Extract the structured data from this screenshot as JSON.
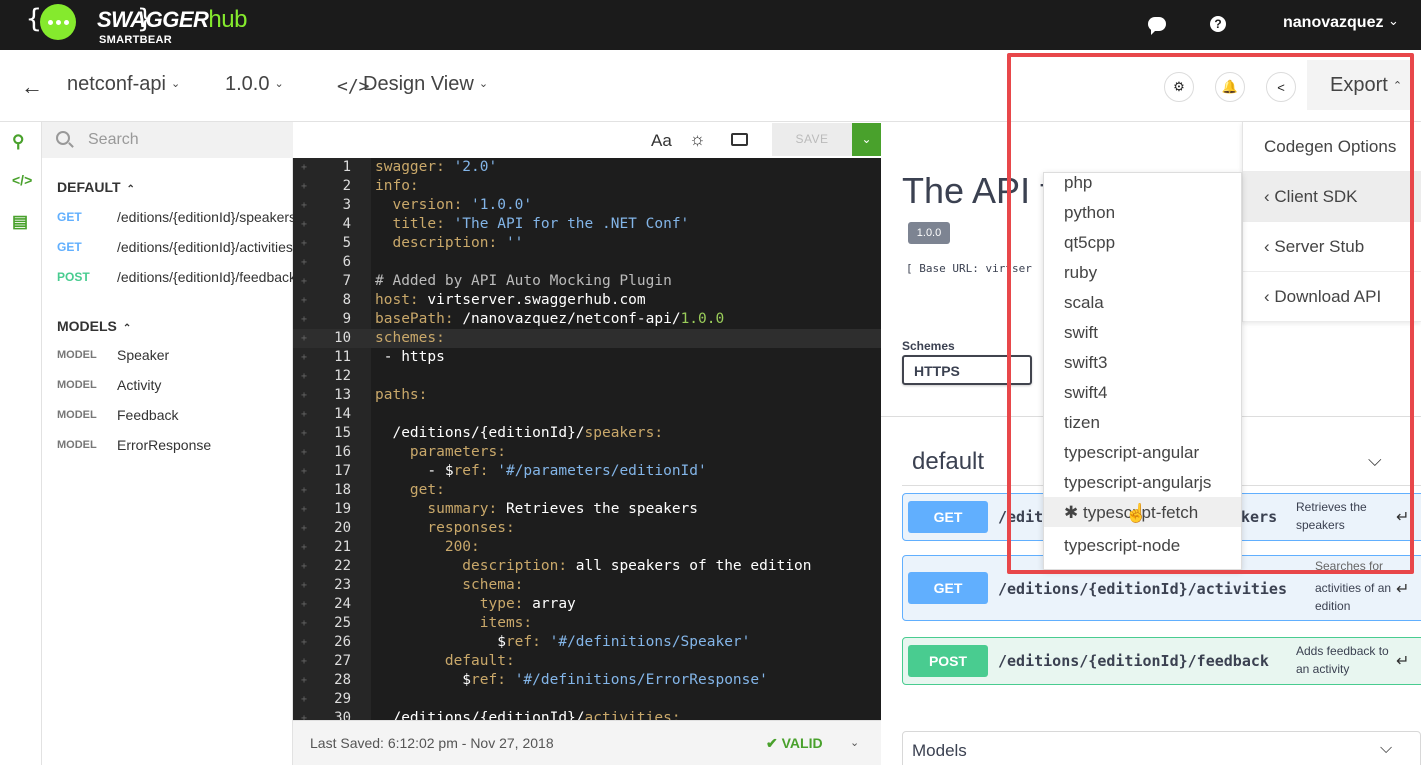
{
  "brand": {
    "name_a": "SWAGGER",
    "name_b": "hub",
    "sub": "SMARTBEAR",
    "braces": "{ }",
    "accent": "#85ea2d"
  },
  "topbar": {
    "username": "nanovazquez",
    "chat_icon": "chat-icon",
    "help_icon": "help-icon"
  },
  "subbar": {
    "api_name": "netconf-api",
    "version": "1.0.0",
    "view": "Design View",
    "export_label": "Export"
  },
  "sidebar": {
    "search_placeholder": "Search",
    "default_section": "DEFAULT",
    "operations": [
      {
        "verb": "GET",
        "path": "/editions/{editionId}/speakers"
      },
      {
        "verb": "GET",
        "path": "/editions/{editionId}/activities"
      },
      {
        "verb": "POST",
        "path": "/editions/{editionId}/feedback"
      }
    ],
    "models_section": "MODELS",
    "model_tag": "MODEL",
    "models": [
      "Speaker",
      "Activity",
      "Feedback",
      "ErrorResponse"
    ]
  },
  "editor": {
    "save_label": "SAVE",
    "font_icon_label": "Aa",
    "lines": [
      {
        "n": "1",
        "parts": [
          [
            "k",
            "swagger: "
          ],
          [
            "s",
            "'2.0'"
          ]
        ]
      },
      {
        "n": "2",
        "parts": [
          [
            "k",
            "info:"
          ]
        ]
      },
      {
        "n": "3",
        "parts": [
          [
            "k",
            "  version: "
          ],
          [
            "s",
            "'1.0.0'"
          ]
        ]
      },
      {
        "n": "4",
        "parts": [
          [
            "k",
            "  title: "
          ],
          [
            "s",
            "'The API for the .NET Conf'"
          ]
        ]
      },
      {
        "n": "5",
        "parts": [
          [
            "k",
            "  description: "
          ],
          [
            "s",
            "''"
          ]
        ]
      },
      {
        "n": "6",
        "parts": []
      },
      {
        "n": "7",
        "parts": [
          [
            "cm",
            "# Added by API Auto Mocking Plugin"
          ]
        ]
      },
      {
        "n": "8",
        "parts": [
          [
            "k",
            "host: "
          ],
          [
            "w",
            "virtserver.swaggerhub.com"
          ]
        ]
      },
      {
        "n": "9",
        "parts": [
          [
            "k",
            "basePath: "
          ],
          [
            "w",
            "/nanovazquez/netconf-api/"
          ],
          [
            "n",
            "1.0.0"
          ]
        ]
      },
      {
        "n": "10",
        "parts": [
          [
            "k",
            "schemes:"
          ]
        ],
        "active": true
      },
      {
        "n": "11",
        "parts": [
          [
            "w",
            " - https"
          ]
        ]
      },
      {
        "n": "12",
        "parts": []
      },
      {
        "n": "13",
        "parts": [
          [
            "k",
            "paths:"
          ]
        ]
      },
      {
        "n": "14",
        "parts": []
      },
      {
        "n": "15",
        "parts": [
          [
            "w",
            "  /editions/{editionId}/"
          ],
          [
            "k",
            "speakers:"
          ]
        ]
      },
      {
        "n": "16",
        "parts": [
          [
            "k",
            "    parameters:"
          ]
        ]
      },
      {
        "n": "17",
        "parts": [
          [
            "w",
            "      - $"
          ],
          [
            "k",
            "ref: "
          ],
          [
            "s",
            "'#/parameters/editionId'"
          ]
        ]
      },
      {
        "n": "18",
        "parts": [
          [
            "k",
            "    get:"
          ]
        ]
      },
      {
        "n": "19",
        "parts": [
          [
            "k",
            "      summary: "
          ],
          [
            "w",
            "Retrieves the speakers"
          ]
        ]
      },
      {
        "n": "20",
        "parts": [
          [
            "k",
            "      responses:"
          ]
        ]
      },
      {
        "n": "21",
        "parts": [
          [
            "k",
            "        200:"
          ]
        ]
      },
      {
        "n": "22",
        "parts": [
          [
            "k",
            "          description: "
          ],
          [
            "w",
            "all speakers of the edition"
          ]
        ]
      },
      {
        "n": "23",
        "parts": [
          [
            "k",
            "          schema:"
          ]
        ]
      },
      {
        "n": "24",
        "parts": [
          [
            "k",
            "            type: "
          ],
          [
            "w",
            "array"
          ]
        ]
      },
      {
        "n": "25",
        "parts": [
          [
            "k",
            "            items:"
          ]
        ]
      },
      {
        "n": "26",
        "parts": [
          [
            "w",
            "              $"
          ],
          [
            "k",
            "ref: "
          ],
          [
            "s",
            "'#/definitions/Speaker'"
          ]
        ]
      },
      {
        "n": "27",
        "parts": [
          [
            "k",
            "        default:"
          ]
        ]
      },
      {
        "n": "28",
        "parts": [
          [
            "w",
            "          $"
          ],
          [
            "k",
            "ref: "
          ],
          [
            "s",
            "'#/definitions/ErrorResponse'"
          ]
        ]
      },
      {
        "n": "29",
        "parts": []
      },
      {
        "n": "30",
        "parts": [
          [
            "w",
            "  /editions/{editionId}/"
          ],
          [
            "k",
            "activities:"
          ]
        ]
      }
    ]
  },
  "status": {
    "last_saved": "Last Saved:  6:12:02 pm   -   Nov 27, 2018",
    "valid": "VALID"
  },
  "preview": {
    "title": "The API f",
    "version_badge": "1.0.0",
    "base_url": "[ Base URL: virtser",
    "schemes_label": "Schemes",
    "scheme_value": "HTTPS",
    "tag": "default",
    "ops": [
      {
        "verb": "GET",
        "path": "/edit",
        "path_end": "akers",
        "summary": "Retrieves the speakers"
      },
      {
        "verb": "GET",
        "path": "/editions/{editionId}/activities",
        "summary_top": "Searches for",
        "summary": "activities of an edition"
      },
      {
        "verb": "POST",
        "path": "/editions/{editionId}/feedback",
        "summary": "Adds feedback to an activity"
      }
    ],
    "models_label": "Models"
  },
  "export_menu": {
    "items": [
      "Codegen Options",
      "‹ Client SDK",
      "‹ Server Stub",
      "‹ Download API"
    ]
  },
  "languages": {
    "items": [
      "php",
      "python",
      "qt5cpp",
      "ruby",
      "scala",
      "swift",
      "swift3",
      "swift4",
      "tizen",
      "typescript-angular",
      "typescript-angularjs",
      "✱ typescript-fetch",
      "typescript-node"
    ],
    "highlighted": "✱ typescript-fetch"
  },
  "colors": {
    "get": "#61affe",
    "post": "#49cc90",
    "valid": "#49a12c",
    "highlight_box": "#e8474a"
  }
}
